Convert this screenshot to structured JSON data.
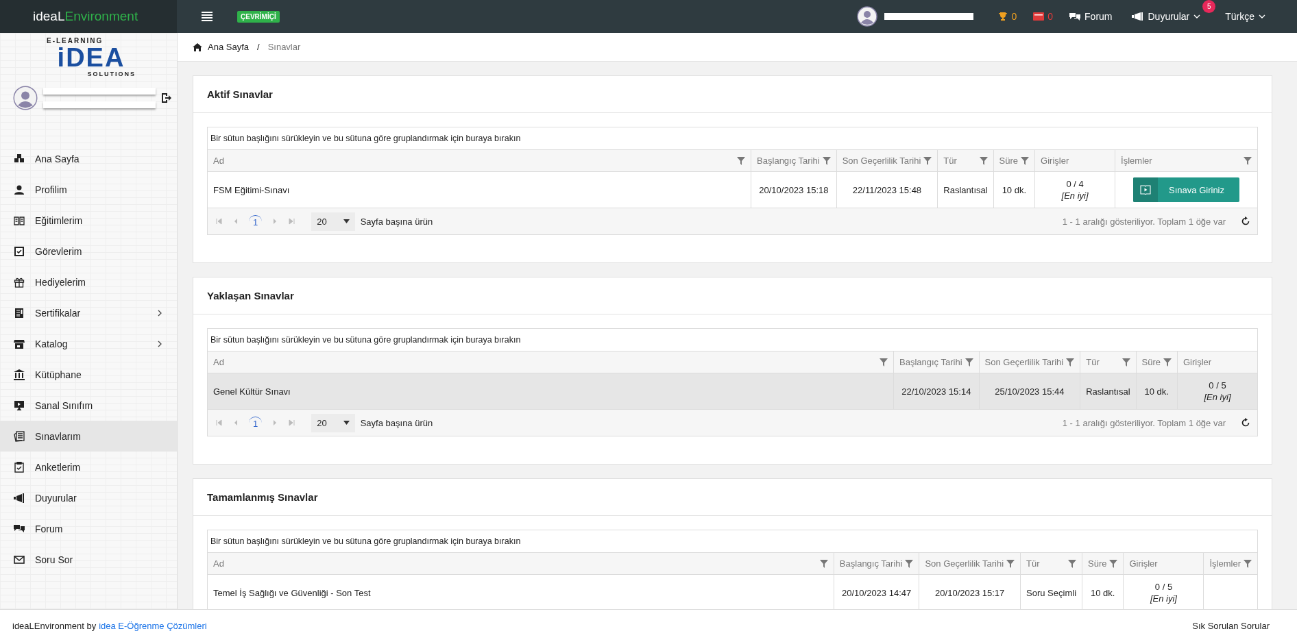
{
  "topbar": {
    "logo_left": "ideaL",
    "logo_right": "Environment",
    "status_badge": "ÇEVRİMİÇİ",
    "trophy_count": "0",
    "card_count": "0",
    "forum": "Forum",
    "announcements": "Duyurular",
    "announcements_badge": "5",
    "language": "Türkçe"
  },
  "sidebar": {
    "logo_top": "E-LEARNING",
    "logo_main": "iDEA",
    "logo_bottom": "SOLUTIONS",
    "items": [
      {
        "label": "Ana Sayfa",
        "expandable": false,
        "selected": false
      },
      {
        "label": "Profilim",
        "expandable": false,
        "selected": false
      },
      {
        "label": "Eğitimlerim",
        "expandable": false,
        "selected": false
      },
      {
        "label": "Görevlerim",
        "expandable": false,
        "selected": false
      },
      {
        "label": "Hediyelerim",
        "expandable": false,
        "selected": false
      },
      {
        "label": "Sertifikalar",
        "expandable": true,
        "selected": false
      },
      {
        "label": "Katalog",
        "expandable": true,
        "selected": false
      },
      {
        "label": "Kütüphane",
        "expandable": false,
        "selected": false
      },
      {
        "label": "Sanal Sınıfım",
        "expandable": false,
        "selected": false
      },
      {
        "label": "Sınavlarım",
        "expandable": false,
        "selected": true
      },
      {
        "label": "Anketlerim",
        "expandable": false,
        "selected": false
      },
      {
        "label": "Duyurular",
        "expandable": false,
        "selected": false
      },
      {
        "label": "Forum",
        "expandable": false,
        "selected": false
      },
      {
        "label": "Soru Sor",
        "expandable": false,
        "selected": false
      }
    ]
  },
  "breadcrumb": {
    "home": "Ana Sayfa",
    "separator": "/",
    "current": "Sınavlar"
  },
  "panels": [
    {
      "title": "Aktif Sınavlar",
      "group_hint": "Bir sütun başlığını sürükleyin ve bu sütuna göre gruplandırmak için buraya bırakın",
      "columns": [
        {
          "label": "Ad",
          "filter": true
        },
        {
          "label": "Başlangıç Tarihi",
          "filter": true
        },
        {
          "label": "Son Geçerlilik Tarihi",
          "filter": true
        },
        {
          "label": "Tür",
          "filter": true
        },
        {
          "label": "Süre",
          "filter": true
        },
        {
          "label": "Girişler",
          "filter": false
        },
        {
          "label": "İşlemler",
          "filter": true
        }
      ],
      "rows": [
        {
          "name": "FSM Eğitimi-Sınavı",
          "start": "20/10/2023 15:18",
          "end": "22/11/2023 15:48",
          "type": "Raslantısal",
          "duration": "10 dk.",
          "entries": "0 / 4",
          "best": "[En iyi]",
          "action": "Sınava Giriniz",
          "selected": false
        }
      ],
      "pager": {
        "page": "1",
        "page_size": "20",
        "page_size_label": "Sayfa başına ürün",
        "info": "1 - 1 aralığı gösteriliyor. Toplam 1 öğe var"
      }
    },
    {
      "title": "Yaklaşan Sınavlar",
      "group_hint": "Bir sütun başlığını sürükleyin ve bu sütuna göre gruplandırmak için buraya bırakın",
      "columns": [
        {
          "label": "Ad",
          "filter": true
        },
        {
          "label": "Başlangıç Tarihi",
          "filter": true
        },
        {
          "label": "Son Geçerlilik Tarihi",
          "filter": true
        },
        {
          "label": "Tür",
          "filter": true
        },
        {
          "label": "Süre",
          "filter": true
        },
        {
          "label": "Girişler",
          "filter": false
        }
      ],
      "rows": [
        {
          "name": "Genel Kültür Sınavı",
          "start": "22/10/2023 15:14",
          "end": "25/10/2023 15:44",
          "type": "Raslantısal",
          "duration": "10 dk.",
          "entries": "0 / 5",
          "best": "[En iyi]",
          "selected": true
        }
      ],
      "pager": {
        "page": "1",
        "page_size": "20",
        "page_size_label": "Sayfa başına ürün",
        "info": "1 - 1 aralığı gösteriliyor. Toplam 1 öğe var"
      }
    },
    {
      "title": "Tamamlanmış Sınavlar",
      "group_hint": "Bir sütun başlığını sürükleyin ve bu sütuna göre gruplandırmak için buraya bırakın",
      "columns": [
        {
          "label": "Ad",
          "filter": true
        },
        {
          "label": "Başlangıç Tarihi",
          "filter": true
        },
        {
          "label": "Son Geçerlilik Tarihi",
          "filter": true
        },
        {
          "label": "Tür",
          "filter": true
        },
        {
          "label": "Süre",
          "filter": true
        },
        {
          "label": "Girişler",
          "filter": false
        },
        {
          "label": "İşlemler",
          "filter": true
        }
      ],
      "rows": [
        {
          "name": "Temel İş Sağlığı ve Güvenliği - Son Test",
          "start": "20/10/2023 14:47",
          "end": "20/10/2023 15:17",
          "type": "Soru Seçimli",
          "duration": "10 dk.",
          "entries": "0 / 5",
          "best": "[En iyi]",
          "selected": false
        }
      ]
    }
  ],
  "footer": {
    "text": "ideaLEnvironment by",
    "link": "idea E-Öğrenme Çözümleri",
    "faq": "Sık Sorulan Sorular"
  }
}
